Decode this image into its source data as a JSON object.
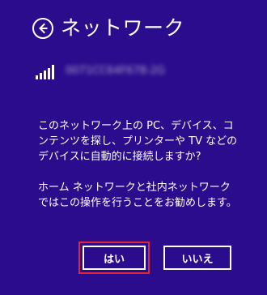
{
  "header": {
    "title": "ネットワーク",
    "back_icon": "arrow-left-circle-icon"
  },
  "network": {
    "signal_icon": "wifi-signal-bars-icon",
    "ssid": "0071CC64F678-2G"
  },
  "message": {
    "paragraph1": "このネットワーク上の PC、デバイス、コンテンツを探し、プリンターや TV などのデバイスに自動的に接続しますか?",
    "paragraph2": "ホーム ネットワークと社内ネットワークではこの操作を行うことをお勧めします。"
  },
  "buttons": {
    "yes_label": "はい",
    "no_label": "いいえ"
  },
  "colors": {
    "background": "#2b0c8c",
    "text": "#ffffff",
    "focus_ring": "#e2263a"
  }
}
